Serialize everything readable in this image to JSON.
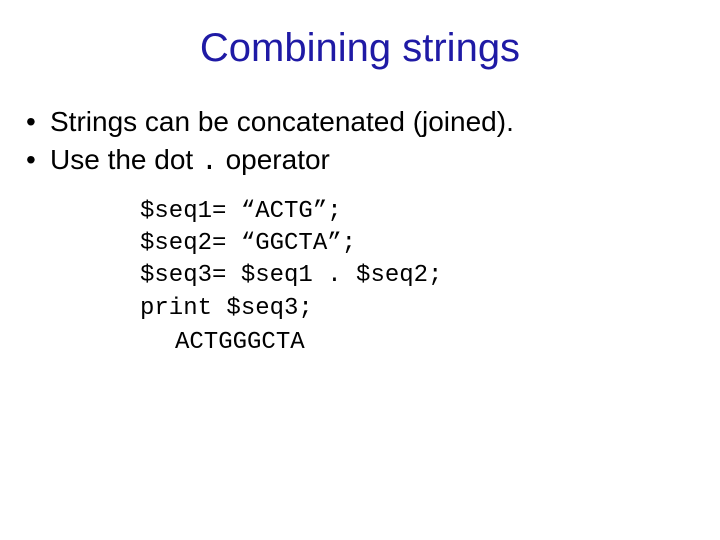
{
  "title": "Combining strings",
  "bullets": [
    "Strings can be concatenated (joined).",
    "Use the dot . operator"
  ],
  "bullet2_prefix": "Use the dot ",
  "bullet2_op": ".",
  "bullet2_suffix": " operator",
  "code": {
    "l1": "$seq1= “ACTG”;",
    "l2": "$seq2= “GGCTA”;",
    "l3": "$seq3= $seq1 . $seq2;",
    "l4": "print $seq3;"
  },
  "output": "ACTGGGCTA"
}
